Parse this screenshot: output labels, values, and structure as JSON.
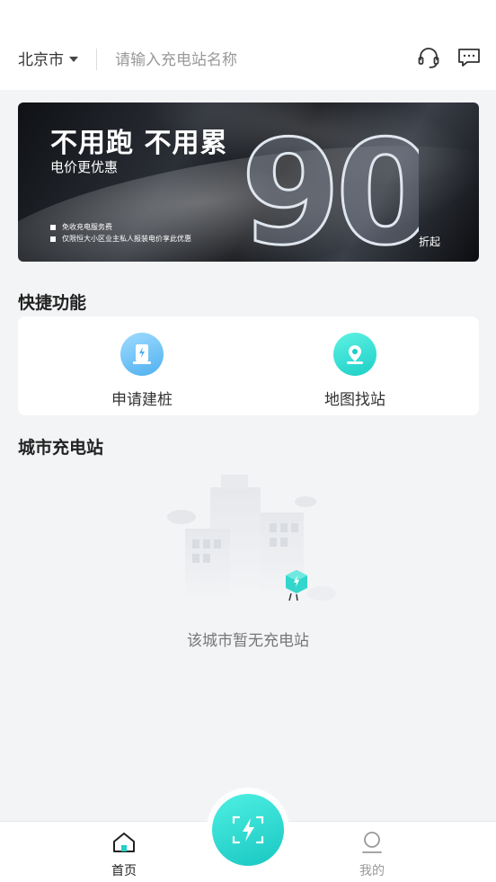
{
  "header": {
    "city": "北京市",
    "search_placeholder": "请输入充电站名称",
    "support_icon": "headset-icon",
    "message_icon": "chat-bubble-icon"
  },
  "banner": {
    "title": "不用跑 不用累",
    "subtitle": "电价更优惠",
    "notes": [
      "免收充电服务费",
      "仅限恒大小区业主私人报装电价享此优惠"
    ],
    "discount_number": "90",
    "discount_suffix": "折起"
  },
  "quick": {
    "title": "快捷功能",
    "items": [
      {
        "label": "申请建桩",
        "icon": "charger-pile-icon"
      },
      {
        "label": "地图找站",
        "icon": "map-pin-icon"
      }
    ]
  },
  "stations": {
    "title": "城市充电站",
    "empty_text": "该城市暂无充电站"
  },
  "tabbar": {
    "tabs": [
      {
        "label": "首页",
        "icon": "home-icon",
        "active": true
      },
      {
        "label": "我的",
        "icon": "profile-icon",
        "active": false
      }
    ],
    "scan_icon": "scan-charge-icon"
  },
  "colors": {
    "accent": "#1fd1c9",
    "accent_blue": "#6ec6f5",
    "text_primary": "#222222",
    "text_muted": "#777777"
  }
}
